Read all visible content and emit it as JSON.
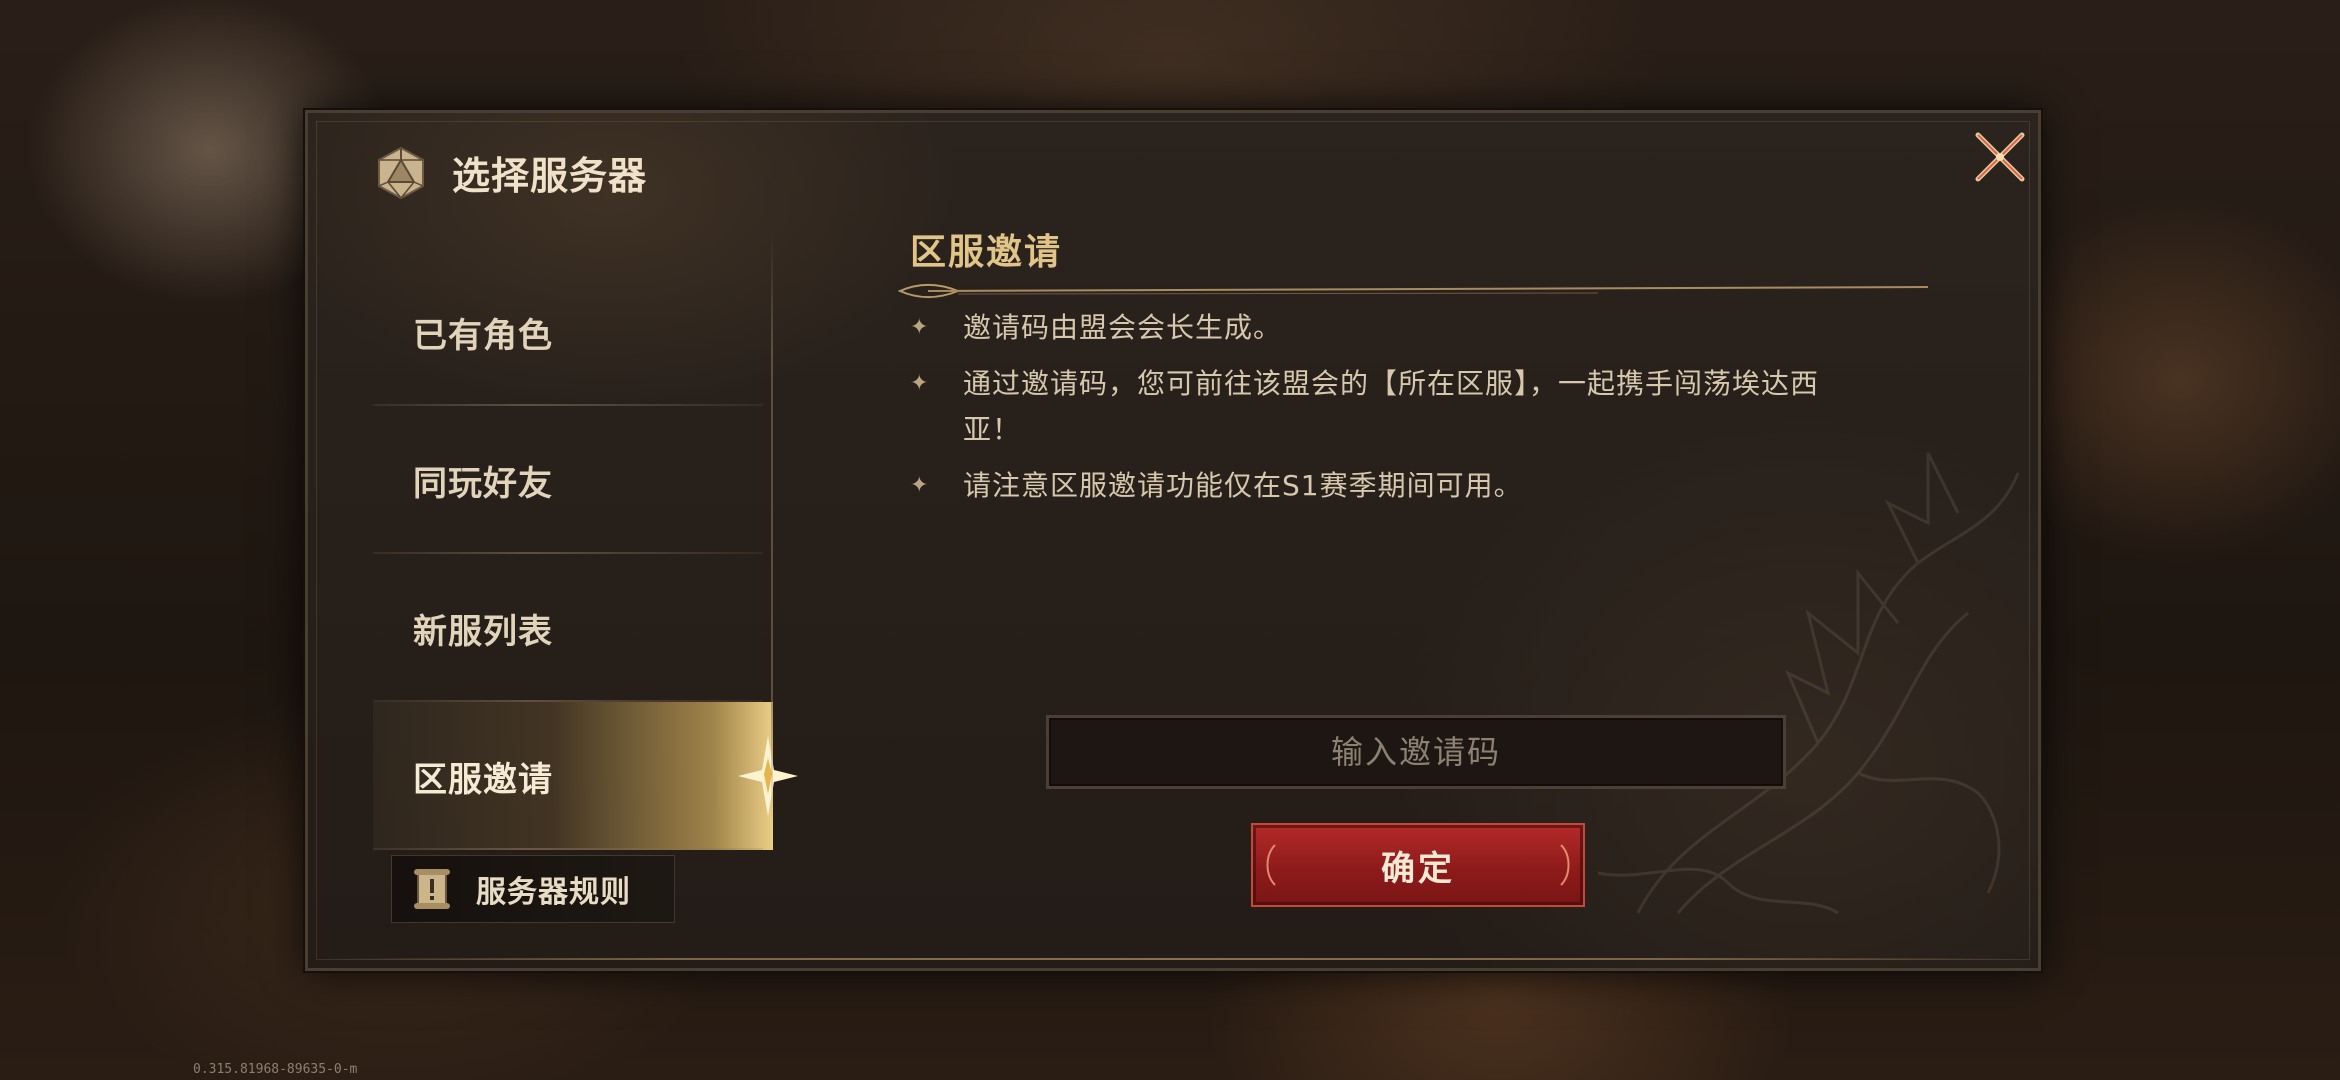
{
  "window": {
    "title": "选择服务器",
    "title_icon": "d20-dice-icon",
    "close_icon": "close-icon"
  },
  "sidebar": {
    "items": [
      {
        "label": "已有角色",
        "active": false
      },
      {
        "label": "同玩好友",
        "active": false
      },
      {
        "label": "新服列表",
        "active": false
      },
      {
        "label": "区服邀请",
        "active": true
      }
    ],
    "rules_button": {
      "label": "服务器规则",
      "icon": "scroll-icon"
    }
  },
  "content": {
    "section_title": "区服邀请",
    "bullets": [
      "邀请码由盟会会长生成。",
      "通过邀请码，您可前往该盟会的【所在区服】，一起携手闯荡埃达西亚！",
      "请注意区服邀请功能仅在S1赛季期间可用。"
    ],
    "input": {
      "placeholder": "输入邀请码",
      "value": ""
    },
    "confirm_label": "确定"
  },
  "version": "0.315.81968-89635-0-m",
  "colors": {
    "accent_gold": "#e0c488",
    "confirm_red": "#9c2020",
    "panel_bg": "#261e19"
  }
}
